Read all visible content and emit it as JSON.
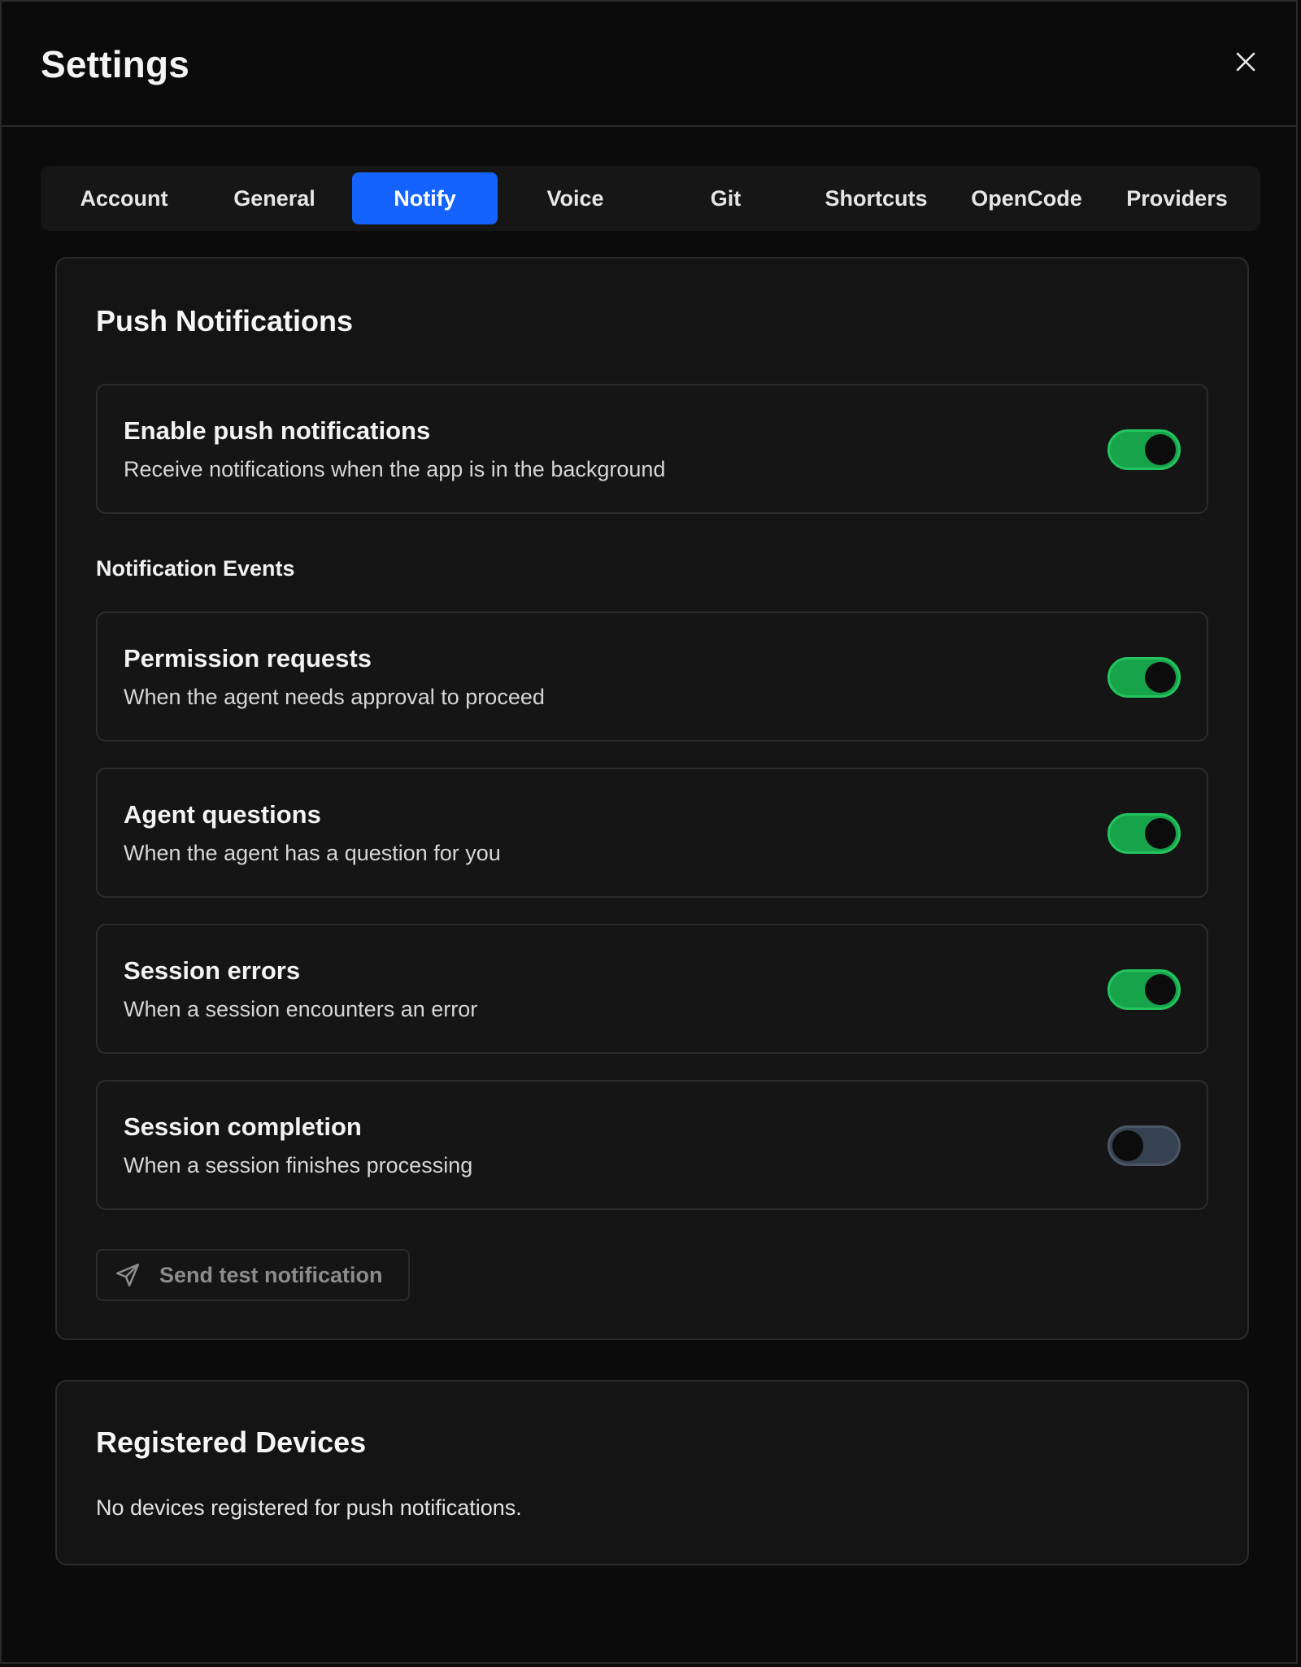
{
  "dialog": {
    "title": "Settings",
    "close_icon": "close-icon"
  },
  "tabs": [
    {
      "label": "Account",
      "active": false
    },
    {
      "label": "General",
      "active": false
    },
    {
      "label": "Notify",
      "active": true
    },
    {
      "label": "Voice",
      "active": false
    },
    {
      "label": "Git",
      "active": false
    },
    {
      "label": "Shortcuts",
      "active": false
    },
    {
      "label": "OpenCode",
      "active": false
    },
    {
      "label": "Providers",
      "active": false
    }
  ],
  "push": {
    "title": "Push Notifications",
    "enable": {
      "title": "Enable push notifications",
      "description": "Receive notifications when the app is in the background",
      "enabled": true
    },
    "events_label": "Notification Events",
    "events": [
      {
        "title": "Permission requests",
        "description": "When the agent needs approval to proceed",
        "enabled": true
      },
      {
        "title": "Agent questions",
        "description": "When the agent has a question for you",
        "enabled": true
      },
      {
        "title": "Session errors",
        "description": "When a session encounters an error",
        "enabled": true
      },
      {
        "title": "Session completion",
        "description": "When a session finishes processing",
        "enabled": false
      }
    ],
    "test_button": {
      "label": "Send test notification",
      "icon": "send-icon"
    }
  },
  "devices": {
    "title": "Registered Devices",
    "empty_text": "No devices registered for push notifications."
  },
  "colors": {
    "accent": "#1463ff",
    "toggle_on": "#16a34a",
    "toggle_off": "#364152",
    "background": "#0b0b0c",
    "card": "#141415"
  }
}
